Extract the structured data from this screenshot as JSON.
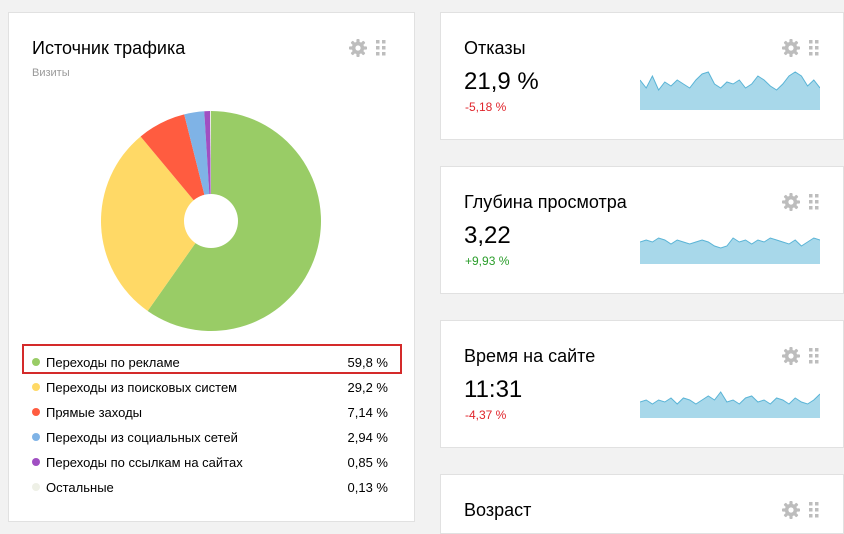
{
  "traffic": {
    "title": "Источник трафика",
    "subtitle": "Визиты",
    "items": [
      {
        "label": "Переходы по рекламе",
        "value": "59,8 %",
        "share": 59.8,
        "color": "#99cc66"
      },
      {
        "label": "Переходы из поисковых систем",
        "value": "29,2 %",
        "share": 29.2,
        "color": "#ffd966"
      },
      {
        "label": "Прямые заходы",
        "value": "7,14 %",
        "share": 7.14,
        "color": "#ff5c40"
      },
      {
        "label": "Переходы из социальных сетей",
        "value": "2,94 %",
        "share": 2.94,
        "color": "#7fb3e6"
      },
      {
        "label": "Переходы по ссылкам на сайтах",
        "value": "0,85 %",
        "share": 0.85,
        "color": "#a04fc2"
      },
      {
        "label": "Остальные",
        "value": "0,13 %",
        "share": 0.13,
        "color": "#eef0e6"
      }
    ]
  },
  "metrics": [
    {
      "title": "Отказы",
      "value": "21,9 %",
      "delta": "-5,18 %",
      "trend": "negative",
      "spark": [
        30,
        22,
        34,
        20,
        28,
        24,
        30,
        26,
        22,
        30,
        36,
        38,
        26,
        22,
        28,
        26,
        30,
        22,
        26,
        34,
        30,
        24,
        20,
        26,
        34,
        38,
        34,
        24,
        30,
        22
      ]
    },
    {
      "title": "Глубина просмотра",
      "value": "3,22",
      "delta": "+9,93 %",
      "trend": "positive",
      "spark": [
        22,
        24,
        22,
        26,
        24,
        20,
        24,
        22,
        20,
        22,
        24,
        22,
        18,
        16,
        18,
        26,
        22,
        24,
        20,
        24,
        22,
        26,
        24,
        22,
        20,
        24,
        18,
        22,
        26,
        24
      ]
    },
    {
      "title": "Время на сайте",
      "value": "11:31",
      "delta": "-4,37 %",
      "trend": "negative",
      "spark": [
        16,
        18,
        14,
        18,
        16,
        20,
        14,
        20,
        18,
        14,
        18,
        22,
        18,
        26,
        16,
        18,
        14,
        20,
        22,
        16,
        18,
        14,
        20,
        18,
        14,
        20,
        16,
        14,
        18,
        24
      ]
    },
    {
      "title": "Возраст",
      "value": "",
      "delta": "",
      "trend": ""
    }
  ],
  "colors": {
    "sparkFill": "#a8d8ea",
    "sparkLine": "#5ab4d6"
  },
  "icons": {
    "settings": "gear-icon",
    "drag": "drag-handle-icon"
  }
}
